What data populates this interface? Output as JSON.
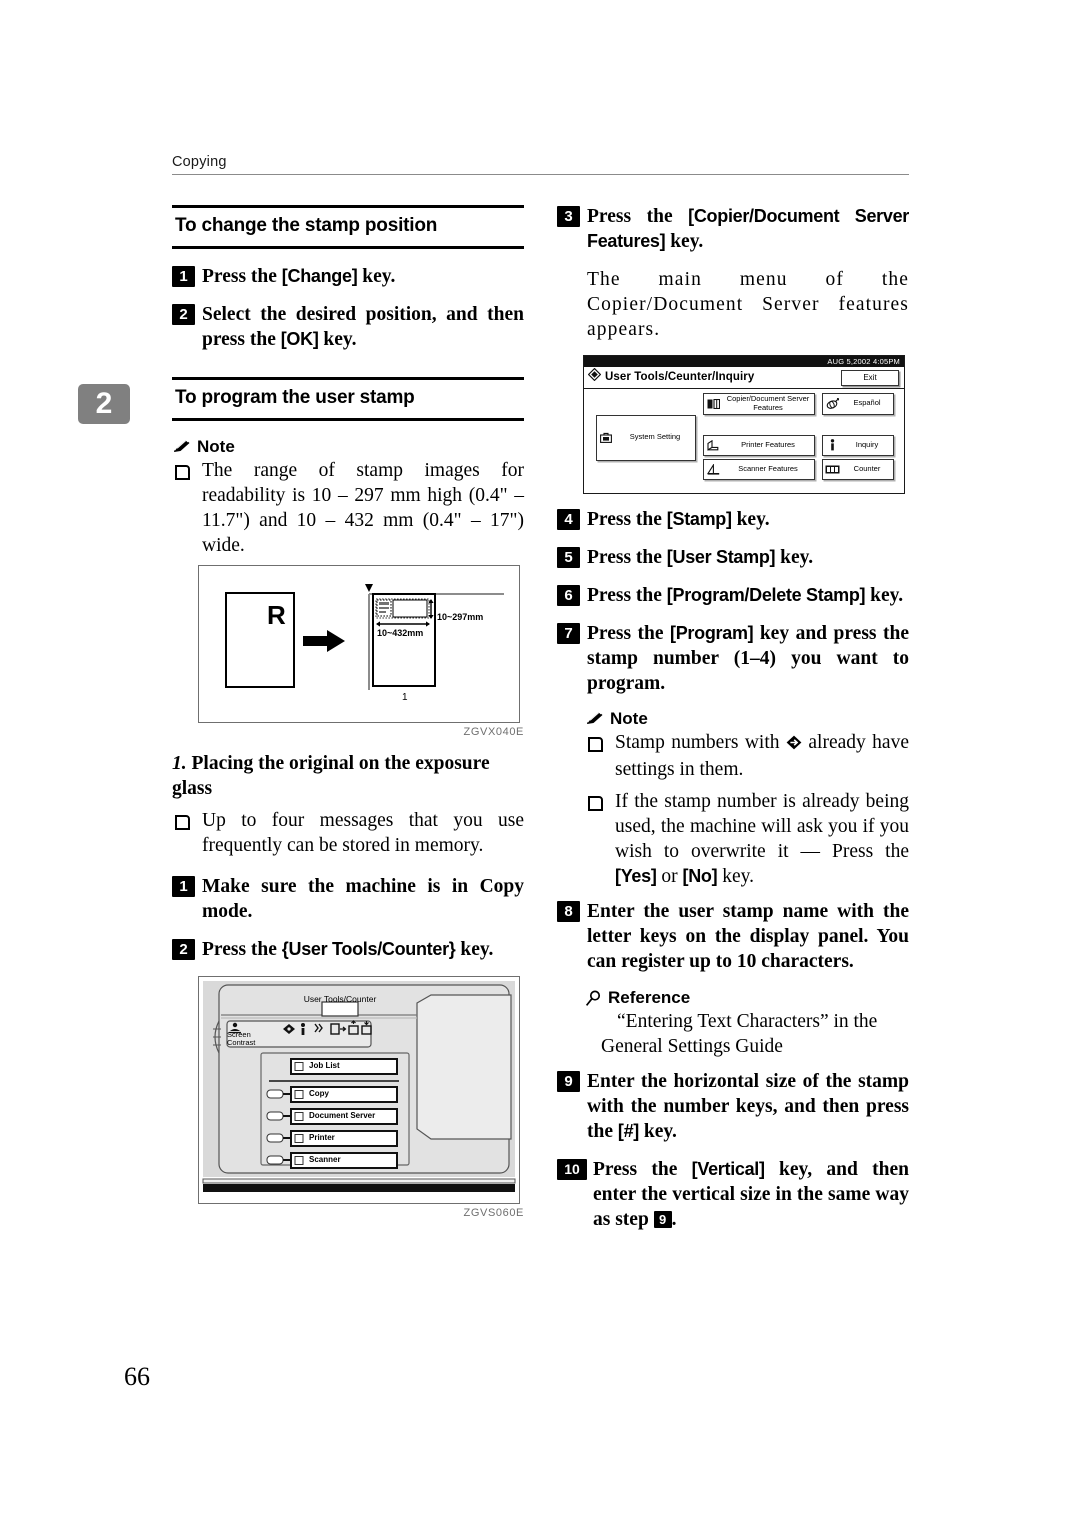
{
  "page": {
    "running_head": "Copying",
    "chapter_tab": "2",
    "page_number": "66"
  },
  "left_column": {
    "section1": {
      "title": "To change the stamp position",
      "steps": [
        {
          "num": "1",
          "text_before": "Press the ",
          "key": "[Change]",
          "text_after": " key."
        },
        {
          "num": "2",
          "text_before": "Select the desired position, and then press the ",
          "key": "[OK]",
          "text_after": " key."
        }
      ]
    },
    "section2": {
      "title": "To program the user stamp",
      "note_label": "Note",
      "note_items": [
        "The range of stamp images for readability is 10 – 297 mm high (0.4\" – 11.7\") and 10 – 432 mm (0.4\" – 17\") wide."
      ],
      "figure_stamp_range": {
        "original_letter": "R",
        "label_vertical": "10~297mm",
        "label_horizontal": "10~432mm",
        "callout_number": "1",
        "figure_id": "ZGVX040E"
      },
      "caption_number": "1.",
      "caption_text": "Placing the original on the exposure glass",
      "bullets": [
        "Up to four messages that you use frequently can be stored in memory."
      ],
      "steps": [
        {
          "num": "1",
          "text_before": "Make sure the machine is in Copy mode.",
          "key": "",
          "text_after": ""
        },
        {
          "num": "2",
          "text_before": "Press the ",
          "key": "{User Tools/Counter}",
          "text_after": " key."
        }
      ],
      "figure_panel": {
        "title_label": "User Tools/Counter",
        "screen_contrast_label": "Screen\nContrast",
        "buttons": [
          "Job List",
          "Copy",
          "Document Server",
          "Printer",
          "Scanner"
        ],
        "figure_id": "ZGVS060E"
      }
    }
  },
  "right_column": {
    "steps": [
      {
        "num": "3",
        "text_before": "Press the ",
        "key": "[Copier/Document Server Features]",
        "text_after": " key."
      },
      {
        "num": "4",
        "text_before": "Press the ",
        "key": "[Stamp]",
        "text_after": " key."
      },
      {
        "num": "5",
        "text_before": "Press the ",
        "key": "[User Stamp]",
        "text_after": " key."
      },
      {
        "num": "6",
        "text_before": "Press the ",
        "key": "[Program/Delete Stamp]",
        "text_after": " key."
      },
      {
        "num": "7",
        "text_before": "Press the ",
        "key": "[Program]",
        "text_after": " key and press the stamp number (1–4) you want to program."
      }
    ],
    "result_text": "The main menu of the Copier/Document Server features appears.",
    "lcd": {
      "clock": "AUG  5,2002  4:05PM",
      "title": "User Tools/Ceunter/Inquiry",
      "exit_label": "Exit",
      "buttons": [
        {
          "label": "System Setting",
          "icon": "toolbox-icon"
        },
        {
          "label": "Copier/Document Server Features",
          "icon": "copier-icon"
        },
        {
          "label": "Español",
          "icon": "globe-icon"
        },
        {
          "label": "Printer Features",
          "icon": "printer-icon"
        },
        {
          "label": "Inquiry",
          "icon": "info-icon"
        },
        {
          "label": "Scanner Features",
          "icon": "scanner-icon"
        },
        {
          "label": "Counter",
          "icon": "counter-icon"
        }
      ]
    },
    "note_label": "Note",
    "note_items": [
      {
        "before": "Stamp numbers with ",
        "icon": "diamond-arrow-icon",
        "after": " already have settings in them."
      },
      {
        "before": "If the stamp number is already being used, the machine will ask you if you wish to overwrite it — Press the ",
        "key1": "[Yes]",
        "mid": " or ",
        "key2": "[No]",
        "after": " key."
      }
    ],
    "step8": {
      "num": "8",
      "text": "Enter the user stamp name with the letter keys on the display panel. You can register up to 10 characters."
    },
    "reference_label": "Reference",
    "reference_text": "“Entering Text Characters” in the General Settings Guide",
    "step9": {
      "num": "9",
      "text_before": "Enter the horizontal size of the stamp with the number keys, and then press the ",
      "key": "[#]",
      "text_after": " key."
    },
    "step10": {
      "num": "10",
      "text_before": "Press the ",
      "key": "[Vertical]",
      "text_after_1": " key, and then enter the vertical size in the same way as step ",
      "inline_step": "9",
      "text_after_2": "."
    }
  }
}
